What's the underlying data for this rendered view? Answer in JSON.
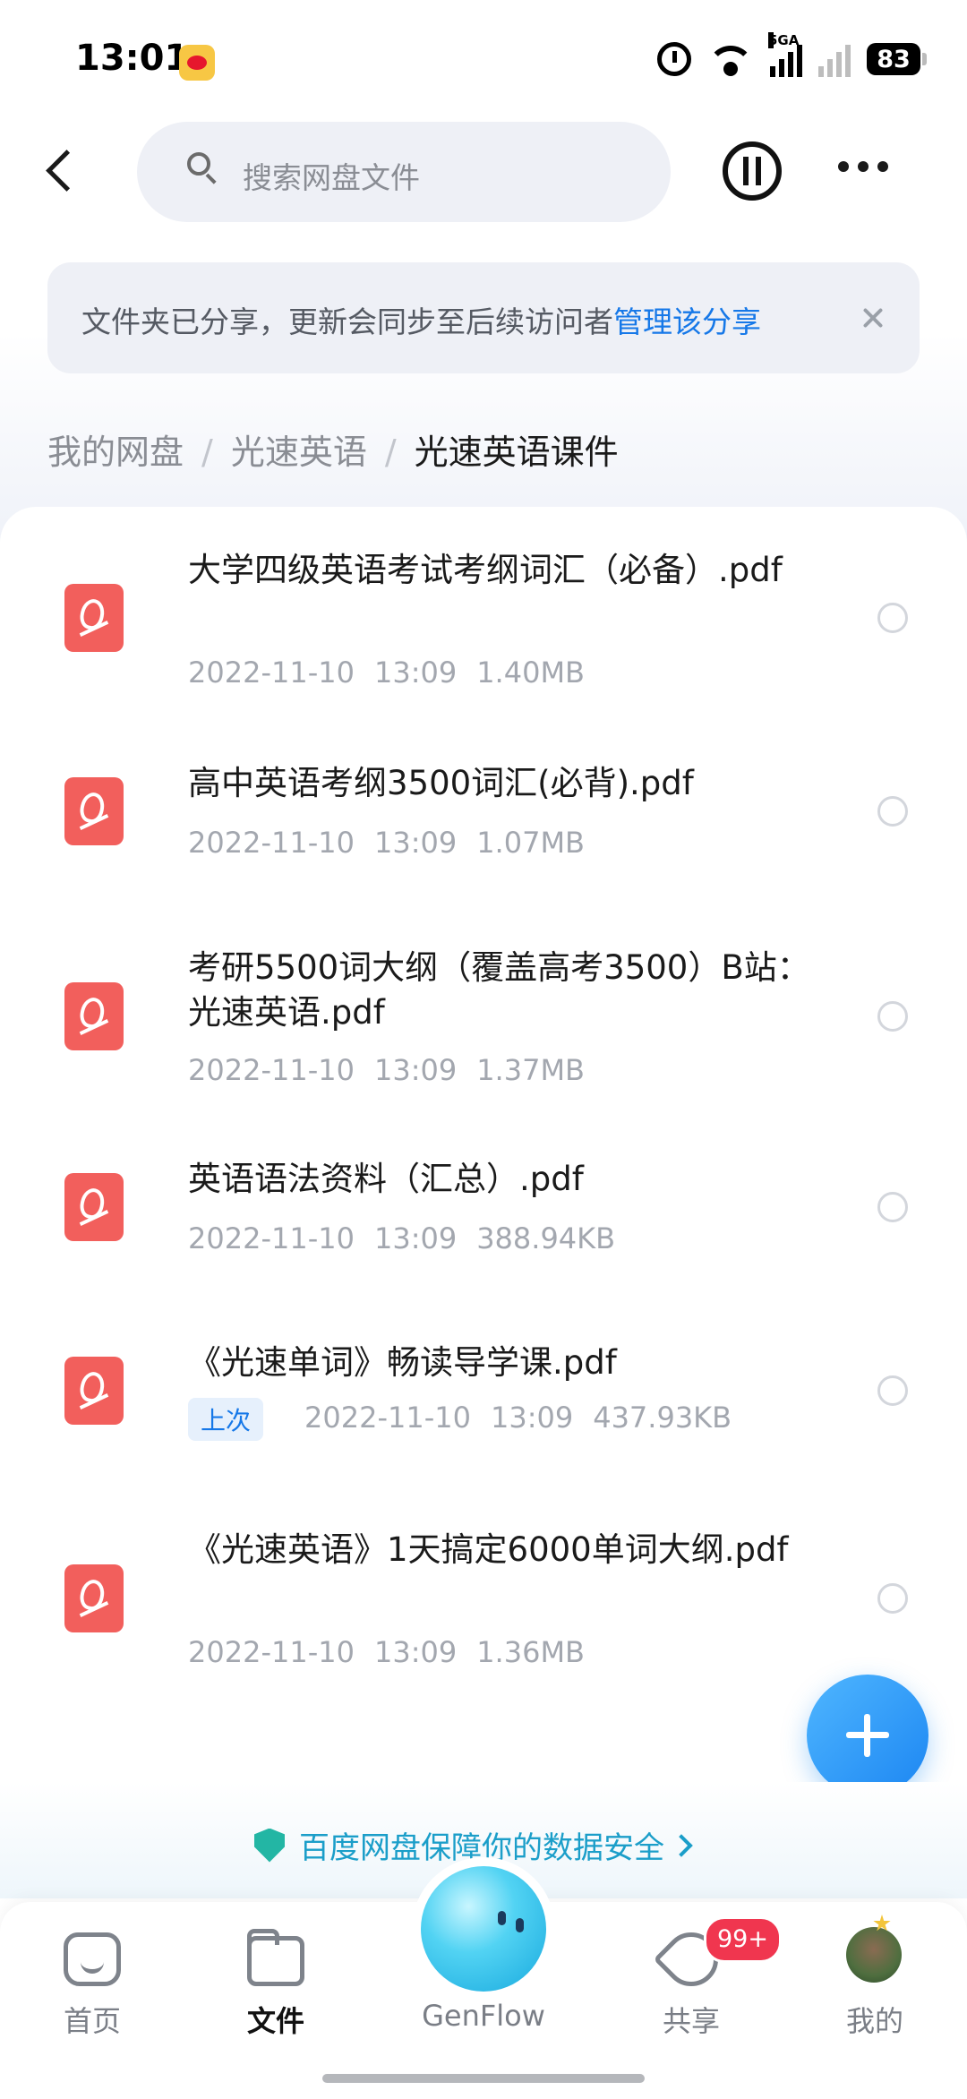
{
  "status_bar": {
    "time": "13:01",
    "network_label": "5GA",
    "battery": "83"
  },
  "header": {
    "search_placeholder": "搜索网盘文件"
  },
  "share_banner": {
    "text": "文件夹已分享，更新会同步至后续访问者",
    "link": "管理该分享"
  },
  "breadcrumb": {
    "items": [
      "我的网盘",
      "光速英语"
    ],
    "separator": "/",
    "current": "光速英语课件"
  },
  "files": [
    {
      "name": "大学四级英语考试考纲词汇（必备）.pdf",
      "date": "2022-11-10",
      "time": "13:09",
      "size": "1.40MB",
      "badge": ""
    },
    {
      "name": "高中英语考纲3500词汇(必背).pdf",
      "date": "2022-11-10",
      "time": "13:09",
      "size": "1.07MB",
      "badge": ""
    },
    {
      "name": "考研5500词大纲（覆盖高考3500）B站：光速英语.pdf",
      "date": "2022-11-10",
      "time": "13:09",
      "size": "1.37MB",
      "badge": ""
    },
    {
      "name": "英语语法资料（汇总）.pdf",
      "date": "2022-11-10",
      "time": "13:09",
      "size": "388.94KB",
      "badge": ""
    },
    {
      "name": "《光速单词》畅读导学课.pdf",
      "date": "2022-11-10",
      "time": "13:09",
      "size": "437.93KB",
      "badge": "上次"
    },
    {
      "name": "《光速英语》1天搞定6000单词大纲.pdf",
      "date": "2022-11-10",
      "time": "13:09",
      "size": "1.36MB",
      "badge": ""
    }
  ],
  "security_notice": "百度网盘保障你的数据安全",
  "bottom_nav": {
    "home": "首页",
    "files": "文件",
    "genflow": "GenFlow",
    "share": "共享",
    "share_badge": "99+",
    "mine": "我的"
  },
  "colors": {
    "accent": "#1678e8",
    "pdf_red": "#f25f5c",
    "badge_red": "#f0364f",
    "security_teal": "#1b9ec9"
  },
  "icons": [
    "back-arrow-icon",
    "search-icon",
    "transfer-icon",
    "more-icon",
    "close-icon",
    "pdf-file-icon",
    "plus-icon",
    "shield-icon",
    "home-icon",
    "folder-icon",
    "share-icon",
    "avatar"
  ]
}
